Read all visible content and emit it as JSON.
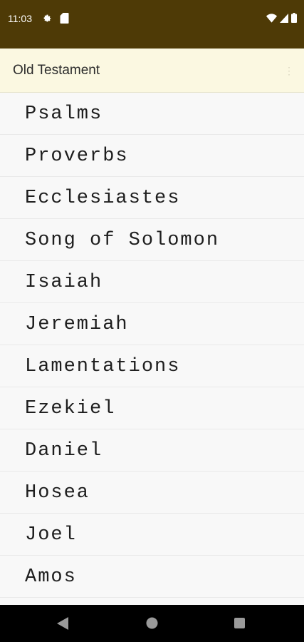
{
  "status_bar": {
    "time": "11:03",
    "icons": [
      "settings-gear-icon",
      "sd-card-icon",
      "wifi-icon",
      "signal-icon",
      "battery-icon"
    ]
  },
  "top_bar": {
    "title": "Old Testament"
  },
  "books": [
    "Psalms",
    "Proverbs",
    "Ecclesiastes",
    "Song of Solomon",
    "Isaiah",
    "Jeremiah",
    "Lamentations",
    "Ezekiel",
    "Daniel",
    "Hosea",
    "Joel",
    "Amos"
  ],
  "colors": {
    "status_bar": "#4e3a06",
    "top_bar": "#fbf8e1",
    "list_bg": "#f8f8f8",
    "nav_bar": "#000000"
  },
  "nav_bar": {
    "icons": [
      "back-triangle-icon",
      "home-circle-icon",
      "recents-square-icon"
    ]
  }
}
